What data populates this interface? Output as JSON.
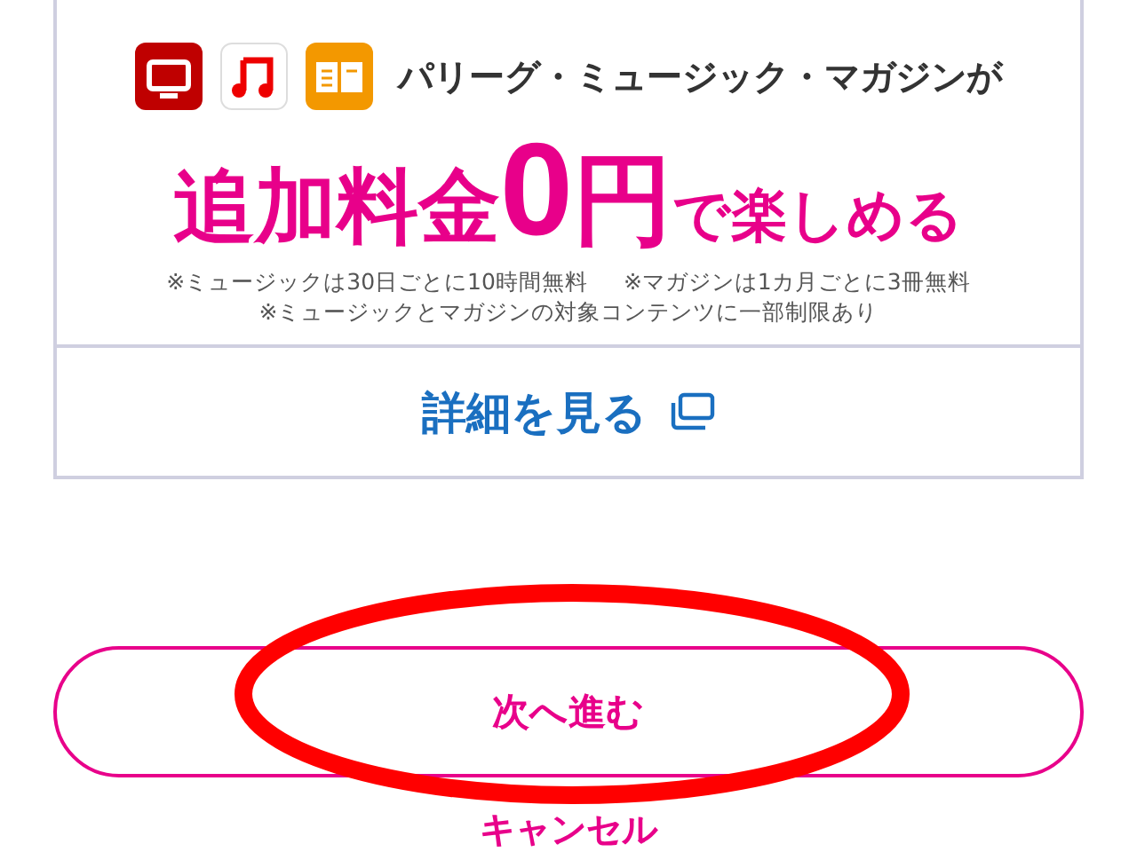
{
  "promo": {
    "services_line": "パリーグ・ミュージック・マガジンが",
    "headline": [
      {
        "text": "追加料金",
        "kind": "large"
      },
      {
        "text": "0",
        "kind": "huge"
      },
      {
        "text": "円",
        "kind": "big"
      },
      {
        "text": "で楽しめる",
        "kind": "medium"
      }
    ],
    "notes": [
      [
        "※ミュージックは30日ごとに10時間無料",
        "※マガジンは1カ月ごとに3冊無料"
      ],
      [
        "※ミュージックとマガジンの対象コンテンツに一部制限あり"
      ]
    ],
    "details_link": "詳細を見る"
  },
  "next_button": "次へ進む",
  "cancel_link": "キャンセル"
}
